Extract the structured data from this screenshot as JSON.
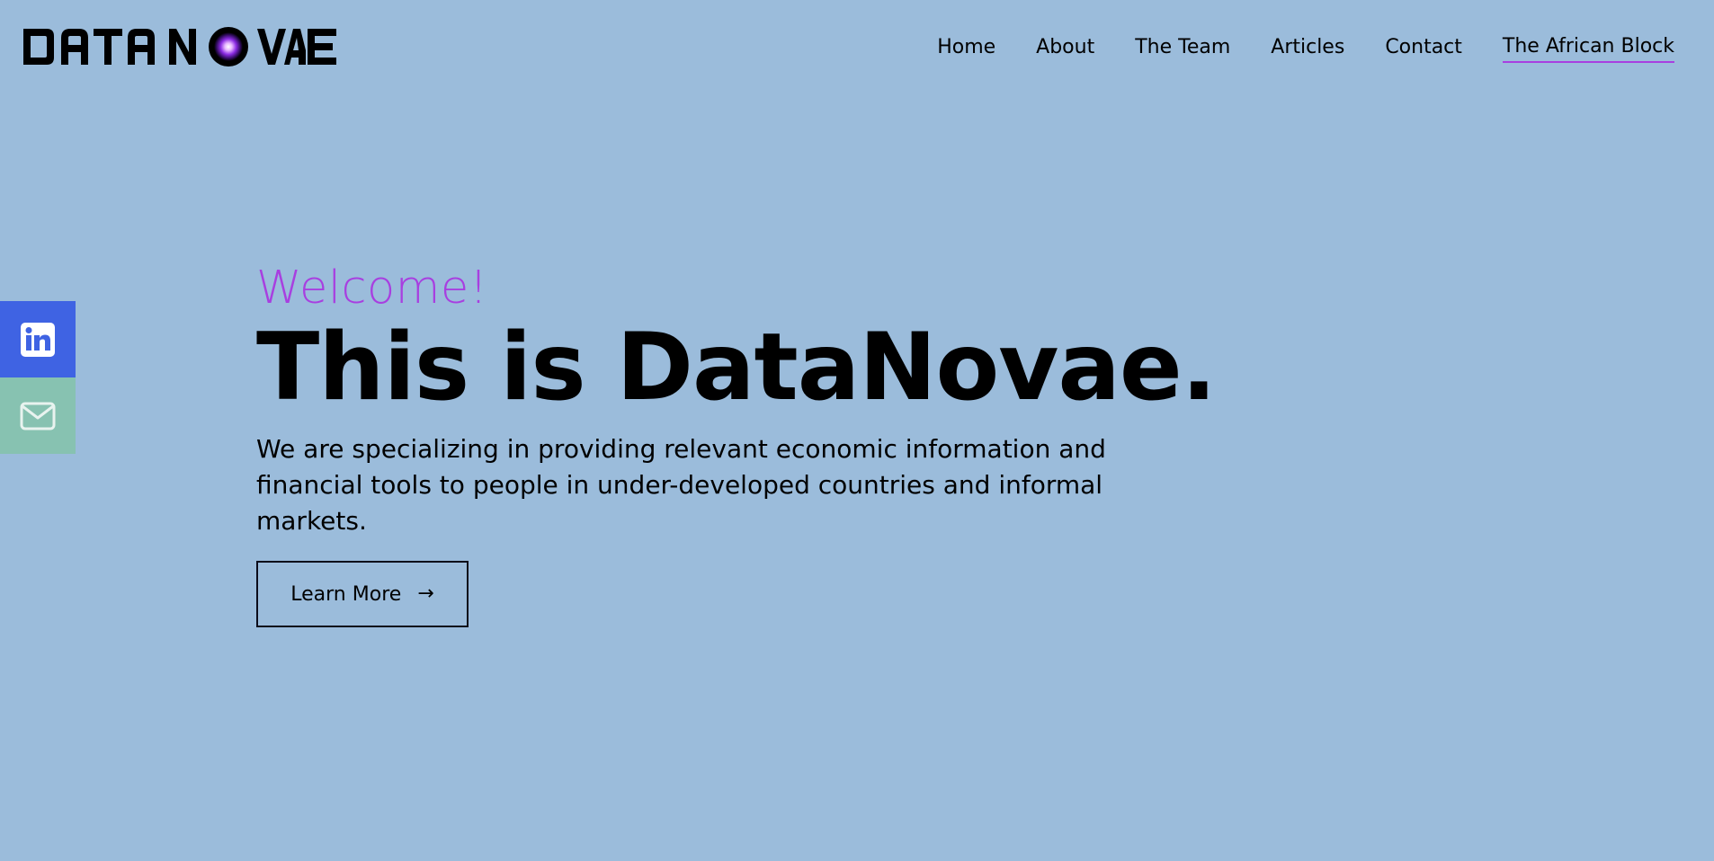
{
  "brand": {
    "logo_text": "DATA NOVAE",
    "logo_icon": "glowing-orb-icon"
  },
  "nav": {
    "items": [
      {
        "label": "Home",
        "active": false
      },
      {
        "label": "About",
        "active": false
      },
      {
        "label": "The Team",
        "active": false
      },
      {
        "label": "Articles",
        "active": false
      },
      {
        "label": "Contact",
        "active": false
      },
      {
        "label": "The African Block",
        "active": true
      }
    ],
    "active_underline_color": "#a83fe0"
  },
  "social": [
    {
      "icon": "linkedin-icon",
      "color": "#3f63e3"
    },
    {
      "icon": "mail-icon",
      "color": "#87c2b1"
    }
  ],
  "hero": {
    "welcome": "Welcome!",
    "headline": "This is DataNovae.",
    "subtitle": "We are specializing in providing relevant economic information and financial tools to people in under-developed countries and informal markets.",
    "cta_label": "Learn More",
    "cta_icon": "arrow-right-icon"
  },
  "colors": {
    "background": "#9bbcdb",
    "accent": "#a83fe0"
  }
}
